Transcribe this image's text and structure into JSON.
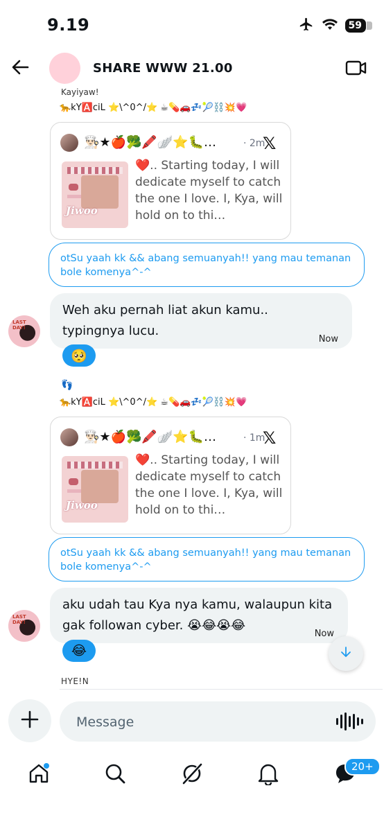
{
  "status_bar": {
    "time": "9.19",
    "battery": "59"
  },
  "header": {
    "title": "SHARE WWW 21.00"
  },
  "thread": {
    "sender1_name": "Kayiyaw!",
    "emoji_line1": "🐆kY🅰️ciL ⭐\\^0^/⭐ ☕💊🚗💤🎾⛓️💥💗",
    "card1": {
      "head_emojis": "👨🏻‍🍳★🍎🥦🖍️🪽⭐🐛…",
      "time": "· 2m",
      "thumb_text": "Jiwoo",
      "body": "❤️.. Starting today, I will dedicate myself to catch the one I love. I, Kya, will hold on to thi…"
    },
    "reply1": "otSu yaah kk && abang semuanyah!! yang mau temanan bole komenya^-^",
    "msg1": {
      "text": "Weh aku pernah liat akun kamu.. typingnya lucu.",
      "time": "Now",
      "reaction": "🥺"
    },
    "sender2_name": "👣",
    "emoji_line2": "🐆kY🅰️ciL ⭐\\^0^/⭐ ☕💊🚗💤🎾⛓️💥💗",
    "card2": {
      "head_emojis": "👨🏻‍🍳★🍎🥦🖍️🪽⭐🐛…",
      "time": "· 1m",
      "thumb_text": "Jiwoo",
      "body": "❤️.. Starting today, I will dedicate myself to catch the one I love. I, Kya, will hold on to thi…"
    },
    "reply2": "otSu yaah kk && abang semuanyah!! yang mau temanan bole komenya^-^",
    "msg2": {
      "text": "aku udah tau Kya nya kamu, walaupun kita gak followan cyber. 😭😂😭😂",
      "time": "Now",
      "reaction": "😂"
    },
    "sender3_name": "HYE!N",
    "avatar_label": "LAST DAY!"
  },
  "composer": {
    "placeholder": "Message"
  },
  "nav": {
    "badge": "20+"
  },
  "colors": {
    "accent": "#1d9bf0",
    "bubble": "#eff3f4",
    "header_avatar": "#ffd1da"
  },
  "icons": [
    "back-arrow-icon",
    "video-call-icon",
    "x-logo-icon",
    "scroll-down-icon",
    "plus-icon",
    "voice-wave-icon",
    "home-icon",
    "search-icon",
    "grok-icon",
    "bell-icon",
    "messages-icon",
    "airplane-icon",
    "wifi-icon"
  ]
}
